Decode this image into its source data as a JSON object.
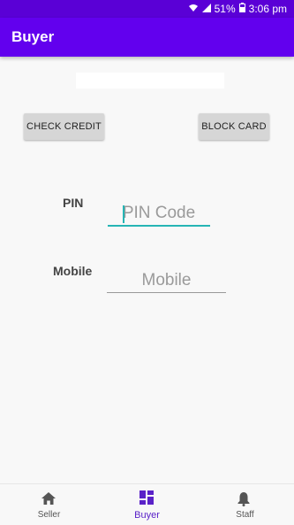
{
  "status_bar": {
    "battery": "51%",
    "time": "3:06 pm"
  },
  "app_bar": {
    "title": "Buyer"
  },
  "buttons": {
    "check_credit": "CHECK CREDIT",
    "block_card": "BLOCK CARD"
  },
  "form": {
    "pin_label": "PIN",
    "pin_placeholder": "PIN Code",
    "mobile_label": "Mobile",
    "mobile_placeholder": "Mobile"
  },
  "bottom_nav": {
    "items": [
      {
        "label": "Seller",
        "icon": "home-icon"
      },
      {
        "label": "Buyer",
        "icon": "dashboard-icon",
        "active": true
      },
      {
        "label": "Staff",
        "icon": "bell-icon"
      }
    ]
  },
  "colors": {
    "primary": "#6200ee",
    "primary_dark": "#5a00d6",
    "accent": "#26b5b5"
  }
}
